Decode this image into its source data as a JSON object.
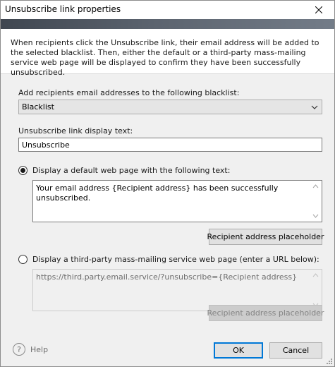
{
  "window": {
    "title": "Unsubscribe link properties"
  },
  "description": "When recipients click the Unsubscribe link, their email address will be added to the selected blacklist. Then, either the default or a third-party mass-mailing service web page will be displayed to confirm they have been successfully unsubscribed.",
  "blacklist": {
    "label": "Add recipients email addresses to the following blacklist:",
    "selected": "Blacklist"
  },
  "link_text": {
    "label": "Unsubscribe link display text:",
    "value": "Unsubscribe"
  },
  "option_default": {
    "label": "Display a default web page with the following text:",
    "checked": true,
    "text": "Your email address {Recipient address} has been successfully unsubscribed.",
    "placeholder_button": "Recipient address placeholder"
  },
  "option_third_party": {
    "label": "Display a third-party mass-mailing service web page (enter a URL below):",
    "checked": false,
    "url": "https://third.party.email.service/?unsubscribe={Recipient address}",
    "placeholder_button": "Recipient address placeholder"
  },
  "footer": {
    "help_label": "Help",
    "ok_label": "OK",
    "cancel_label": "Cancel"
  },
  "icons": {
    "close": "close-icon",
    "dropdown": "chevron-down-icon",
    "help": "help-icon",
    "scroll_up": "scroll-up-arrow-icon",
    "scroll_down": "scroll-down-arrow-icon",
    "resize": "resize-grip-icon"
  },
  "colors": {
    "accent": "#0078d7",
    "banner_start": "#3f4650",
    "banner_end": "#737c88"
  }
}
